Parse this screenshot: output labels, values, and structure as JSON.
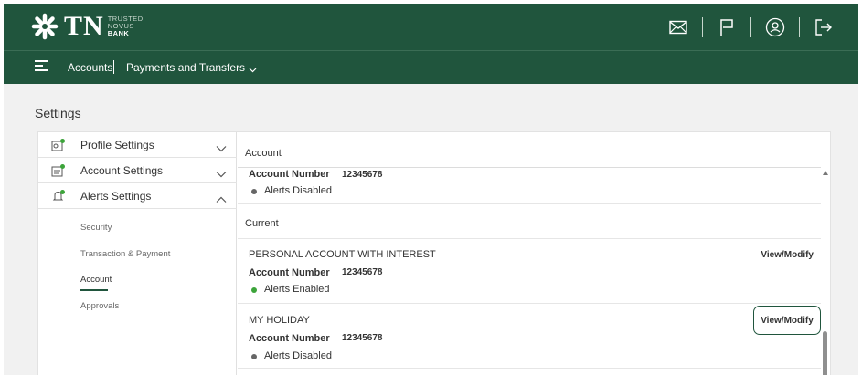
{
  "colors": {
    "brand_green": "#20553d",
    "alert_enabled": "#3ca43a",
    "alert_disabled": "#666666"
  },
  "header": {
    "logo": {
      "mark": "TN",
      "line1": "TRUSTED",
      "line2": "NOVUS",
      "line3": "BANK"
    },
    "icons": [
      "mail-icon",
      "flag-icon",
      "user-avatar-icon",
      "logout-icon"
    ]
  },
  "nav": {
    "menu_icon": "hamburger-icon",
    "items": [
      {
        "label": "Accounts"
      },
      {
        "label": "Payments and Transfers",
        "icon": "chevron-down-icon"
      }
    ]
  },
  "page": {
    "title": "Settings"
  },
  "settings_menu": {
    "items": [
      {
        "label": "Profile Settings",
        "icon": "profile-settings-icon",
        "expanded": false
      },
      {
        "label": "Account Settings",
        "icon": "account-settings-icon",
        "expanded": false
      },
      {
        "label": "Alerts Settings",
        "icon": "alerts-bell-icon",
        "expanded": true
      }
    ],
    "sub_items": [
      {
        "label": "Security"
      },
      {
        "label": "Transaction & Payment"
      },
      {
        "label": "Account",
        "active": true
      },
      {
        "label": "Approvals"
      }
    ]
  },
  "content": {
    "section_account": "Account",
    "top_account": {
      "number_label": "Account Number",
      "number": "12345678",
      "status": "Alerts Disabled"
    },
    "section_current": "Current",
    "accounts": [
      {
        "name": "PERSONAL ACCOUNT WITH INTEREST",
        "number_label": "Account Number",
        "number": "12345678",
        "status": "Alerts Enabled",
        "action": "View/Modify"
      },
      {
        "name": "MY HOLIDAY",
        "number_label": "Account Number",
        "number": "12345678",
        "status": "Alerts Disabled",
        "action": "View/Modify"
      }
    ]
  }
}
